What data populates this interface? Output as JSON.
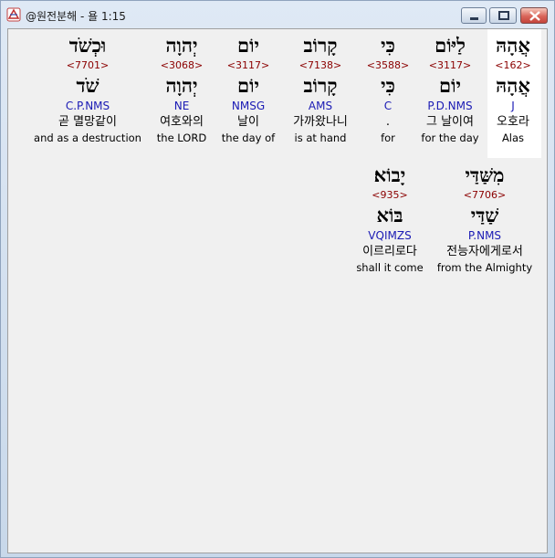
{
  "window": {
    "title": "@원전분해 - 욜 1:15"
  },
  "row1": [
    {
      "hebrew": "אֲהָהּ",
      "strong": "<162>",
      "lemma": "אֲהָהּ",
      "morph": "J",
      "korean": "오호라",
      "english": "Alas"
    },
    {
      "hebrew": "לַיּוֹם",
      "strong": "<3117>",
      "lemma": "יוֹם",
      "morph": "P.D.NMS",
      "korean": "그 날이여",
      "english": "for the day"
    },
    {
      "hebrew": "כִּי",
      "strong": "<3588>",
      "lemma": "כִּי",
      "morph": "C",
      "korean": ".",
      "english": "for"
    },
    {
      "hebrew": "קָרוֹב",
      "strong": "<7138>",
      "lemma": "קָרוֹב",
      "morph": "AMS",
      "korean": "가까왔나니",
      "english": "is at hand"
    },
    {
      "hebrew": "יוֹם",
      "strong": "<3117>",
      "lemma": "יוֹם",
      "morph": "NMSG",
      "korean": "날이",
      "english": "the day of"
    },
    {
      "hebrew": "יְהוָה",
      "strong": "<3068>",
      "lemma": "יְהוָה",
      "morph": "NE",
      "korean": "여호와의",
      "english": "the LORD"
    },
    {
      "hebrew": "וּכְשֹׁד",
      "strong": "<7701>",
      "lemma": "שֹׁד",
      "morph": "C.P.NMS",
      "korean": "곧 멸망같이",
      "english": "and as a destruction"
    }
  ],
  "row2": [
    {
      "hebrew": "מִשַּׁדַּי",
      "strong": "<7706>",
      "lemma": "שַׁדַּי",
      "morph": "P.NMS",
      "korean": "전능자에게로서",
      "english": "from the Almighty"
    },
    {
      "hebrew": "יָבוֹא׃",
      "strong": "<935>",
      "lemma": "בּוֹא",
      "morph": "VQIMZS",
      "korean": "이르리로다",
      "english": "shall it come"
    }
  ]
}
